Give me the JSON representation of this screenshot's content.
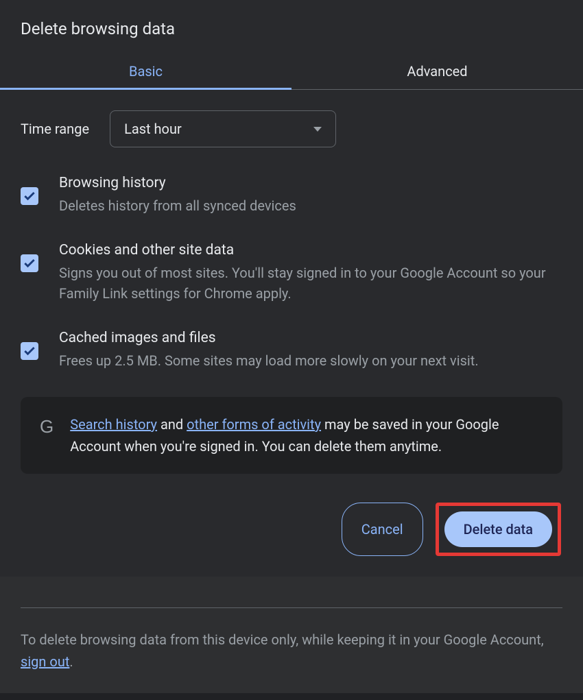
{
  "title": "Delete browsing data",
  "tabs": {
    "basic": "Basic",
    "advanced": "Advanced"
  },
  "timeRange": {
    "label": "Time range",
    "value": "Last hour"
  },
  "options": {
    "browsingHistory": {
      "title": "Browsing history",
      "desc": "Deletes history from all synced devices"
    },
    "cookies": {
      "title": "Cookies and other site data",
      "desc": "Signs you out of most sites. You'll stay signed in to your Google Account so your Family Link settings for Chrome apply."
    },
    "cache": {
      "title": "Cached images and files",
      "desc": "Frees up 2.5 MB. Some sites may load more slowly on your next visit."
    }
  },
  "infoBox": {
    "searchHistoryLink": "Search history",
    "text1": " and ",
    "otherFormsLink": "other forms of activity",
    "text2": " may be saved in your Google Account when you're signed in. You can delete them anytime."
  },
  "buttons": {
    "cancel": "Cancel",
    "delete": "Delete data"
  },
  "footer": {
    "text1": "To delete browsing data from this device only, while keeping it in your Google Account, ",
    "signOutLink": "sign out",
    "text2": "."
  }
}
